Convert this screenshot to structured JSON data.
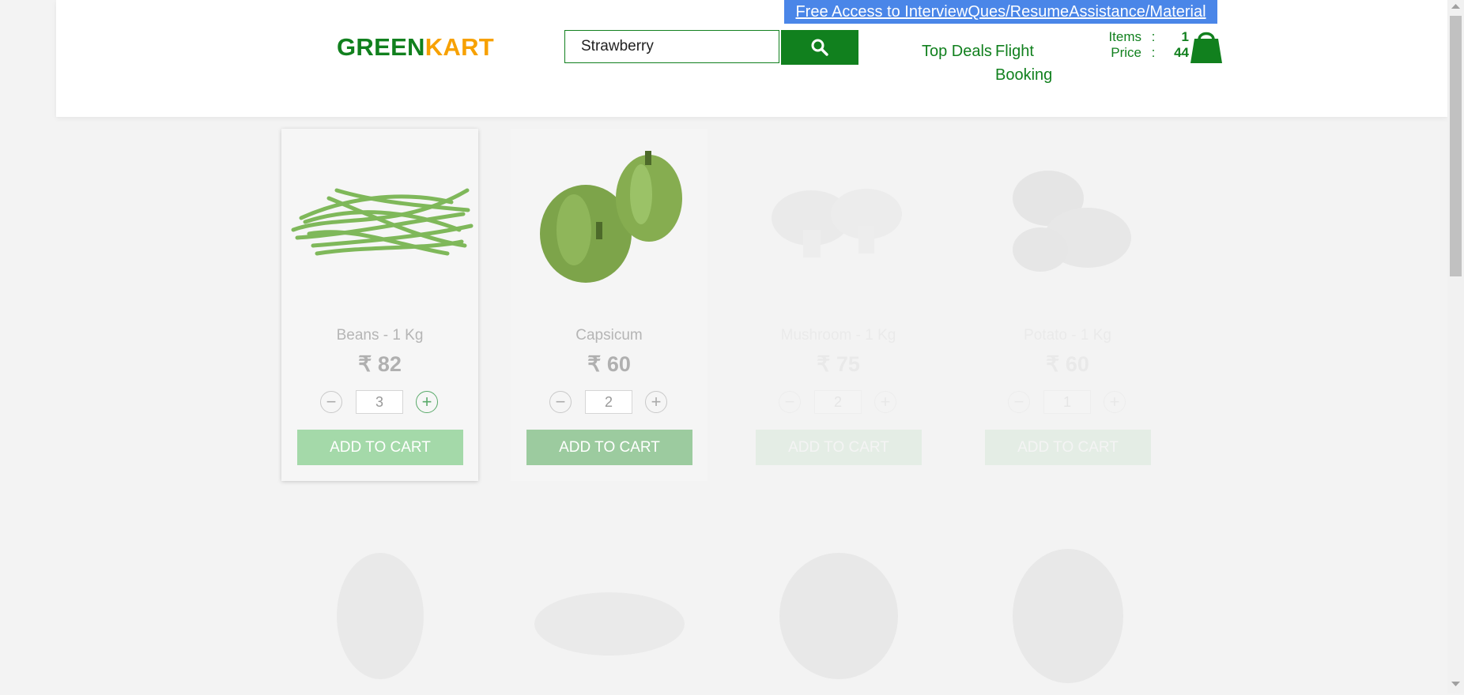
{
  "header": {
    "promo_link": "Free Access to InterviewQues/ResumeAssistance/Material",
    "logo_green": "GREEN",
    "logo_orange": "KART",
    "search": {
      "value": "Strawberry"
    },
    "nav": {
      "top_deals": "Top Deals",
      "flight_booking": "Flight Booking"
    },
    "cart": {
      "items_label": "Items",
      "items_value": "1",
      "price_label": "Price",
      "price_value": "44",
      "separator": ":"
    },
    "brand_colors": {
      "green": "#11801e",
      "orange": "#f7a100",
      "promo_blue": "#4a86e8"
    }
  },
  "products": [
    {
      "name": "Beans - 1 Kg",
      "price": "₹ 82",
      "quantity": "3",
      "add_label": "ADD TO CART",
      "image": "green-beans"
    },
    {
      "name": "Capsicum",
      "price": "₹ 60",
      "quantity": "2",
      "add_label": "ADD TO CART",
      "image": "green-capsicum"
    },
    {
      "name": "Mushroom - 1 Kg",
      "price": "₹ 75",
      "quantity": "2",
      "add_label": "ADD TO CART",
      "image": "mushroom"
    },
    {
      "name": "Potato - 1 Kg",
      "price": "₹ 60",
      "quantity": "1",
      "add_label": "ADD TO CART",
      "image": "potato"
    }
  ],
  "icons": {
    "search": "search-icon",
    "cart": "shopping-bag-icon",
    "decrement": "minus-icon",
    "increment": "plus-icon",
    "currency": "rupee"
  },
  "stepper": {
    "minus": "−",
    "plus": "+"
  }
}
